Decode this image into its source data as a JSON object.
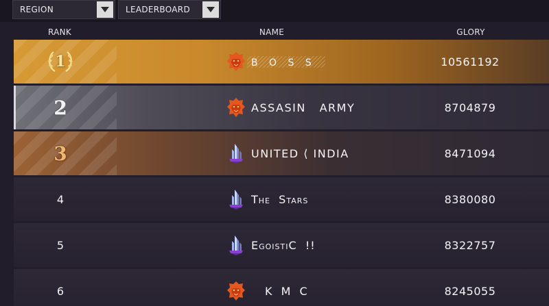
{
  "filters": {
    "region_label": "REGION",
    "leaderboard_label": "LEADERBOARD"
  },
  "columns": {
    "rank": "RANK",
    "name": "NAME",
    "glory": "GLORY"
  },
  "rows": [
    {
      "rank": "1",
      "name": "B O S S",
      "glory": "10561192",
      "tier": "gold",
      "icon": "lion-emblem-icon"
    },
    {
      "rank": "2",
      "name": "ASSASIN   ARMY",
      "glory": "8704879",
      "tier": "silver",
      "icon": "lion-emblem-icon"
    },
    {
      "rank": "3",
      "name": "UNITED ⟨ INDIA",
      "glory": "8471094",
      "tier": "bronze",
      "icon": "crystal-tower-icon"
    },
    {
      "rank": "4",
      "name": "The  Stars",
      "glory": "8380080",
      "tier": "normal",
      "icon": "crystal-tower-icon"
    },
    {
      "rank": "5",
      "name": "EgoistiC  !!",
      "glory": "8322757",
      "tier": "normal",
      "icon": "crystal-tower-icon"
    },
    {
      "rank": "6",
      "name": "K M C",
      "glory": "8245055",
      "tier": "normal",
      "icon": "lion-emblem-icon"
    }
  ],
  "colors": {
    "gold": "#d79a35",
    "silver": "#6f7078",
    "bronze": "#9c6234",
    "row": "#2d2836",
    "background": "#221d2a"
  }
}
